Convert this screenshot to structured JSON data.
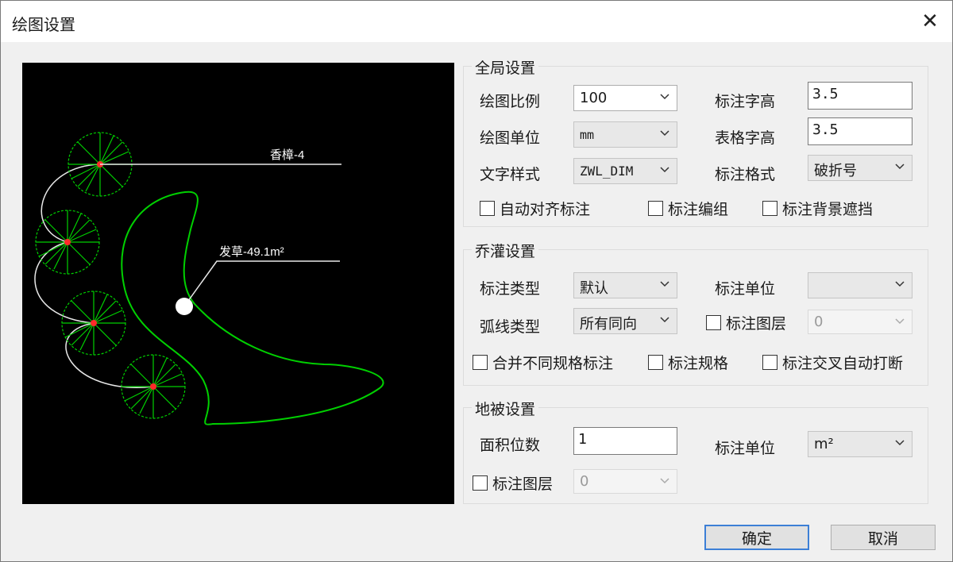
{
  "window": {
    "title": "绘图设置"
  },
  "preview": {
    "labels": [
      "香樟-4",
      "发草-49.1m²"
    ]
  },
  "global": {
    "title": "全局设置",
    "scale_label": "绘图比例",
    "scale_value": "100",
    "unit_label": "绘图单位",
    "unit_value": "mm",
    "text_style_label": "文字样式",
    "text_style_value": "ZWL_DIM",
    "anno_height_label": "标注字高",
    "anno_height_value": "3.5",
    "table_height_label": "表格字高",
    "table_height_value": "3.5",
    "anno_format_label": "标注格式",
    "anno_format_value": "破折号",
    "auto_align_label": "自动对齐标注",
    "group_label": "标注编组",
    "bg_mask_label": "标注背景遮挡"
  },
  "shrub": {
    "title": "乔灌设置",
    "anno_type_label": "标注类型",
    "anno_type_value": "默认",
    "anno_unit_label": "标注单位",
    "anno_unit_value": "",
    "arc_type_label": "弧线类型",
    "arc_type_value": "所有同向",
    "layer_label": "标注图层",
    "layer_value": "0",
    "merge_label": "合并不同规格标注",
    "spec_label": "标注规格",
    "cross_break_label": "标注交叉自动打断"
  },
  "ground": {
    "title": "地被设置",
    "area_digits_label": "面积位数",
    "area_digits_value": "1",
    "anno_unit_label": "标注单位",
    "anno_unit_value": "m²",
    "layer_label": "标注图层",
    "layer_value": "0"
  },
  "buttons": {
    "ok": "确定",
    "cancel": "取消"
  },
  "colors": {
    "plant": "#00d000",
    "marker": "#ff2a2a",
    "leader": "#ffffff",
    "accent": "#3c7fd6"
  },
  "icons": {
    "close": "close-icon",
    "dropdown": "chevron-down-icon"
  }
}
